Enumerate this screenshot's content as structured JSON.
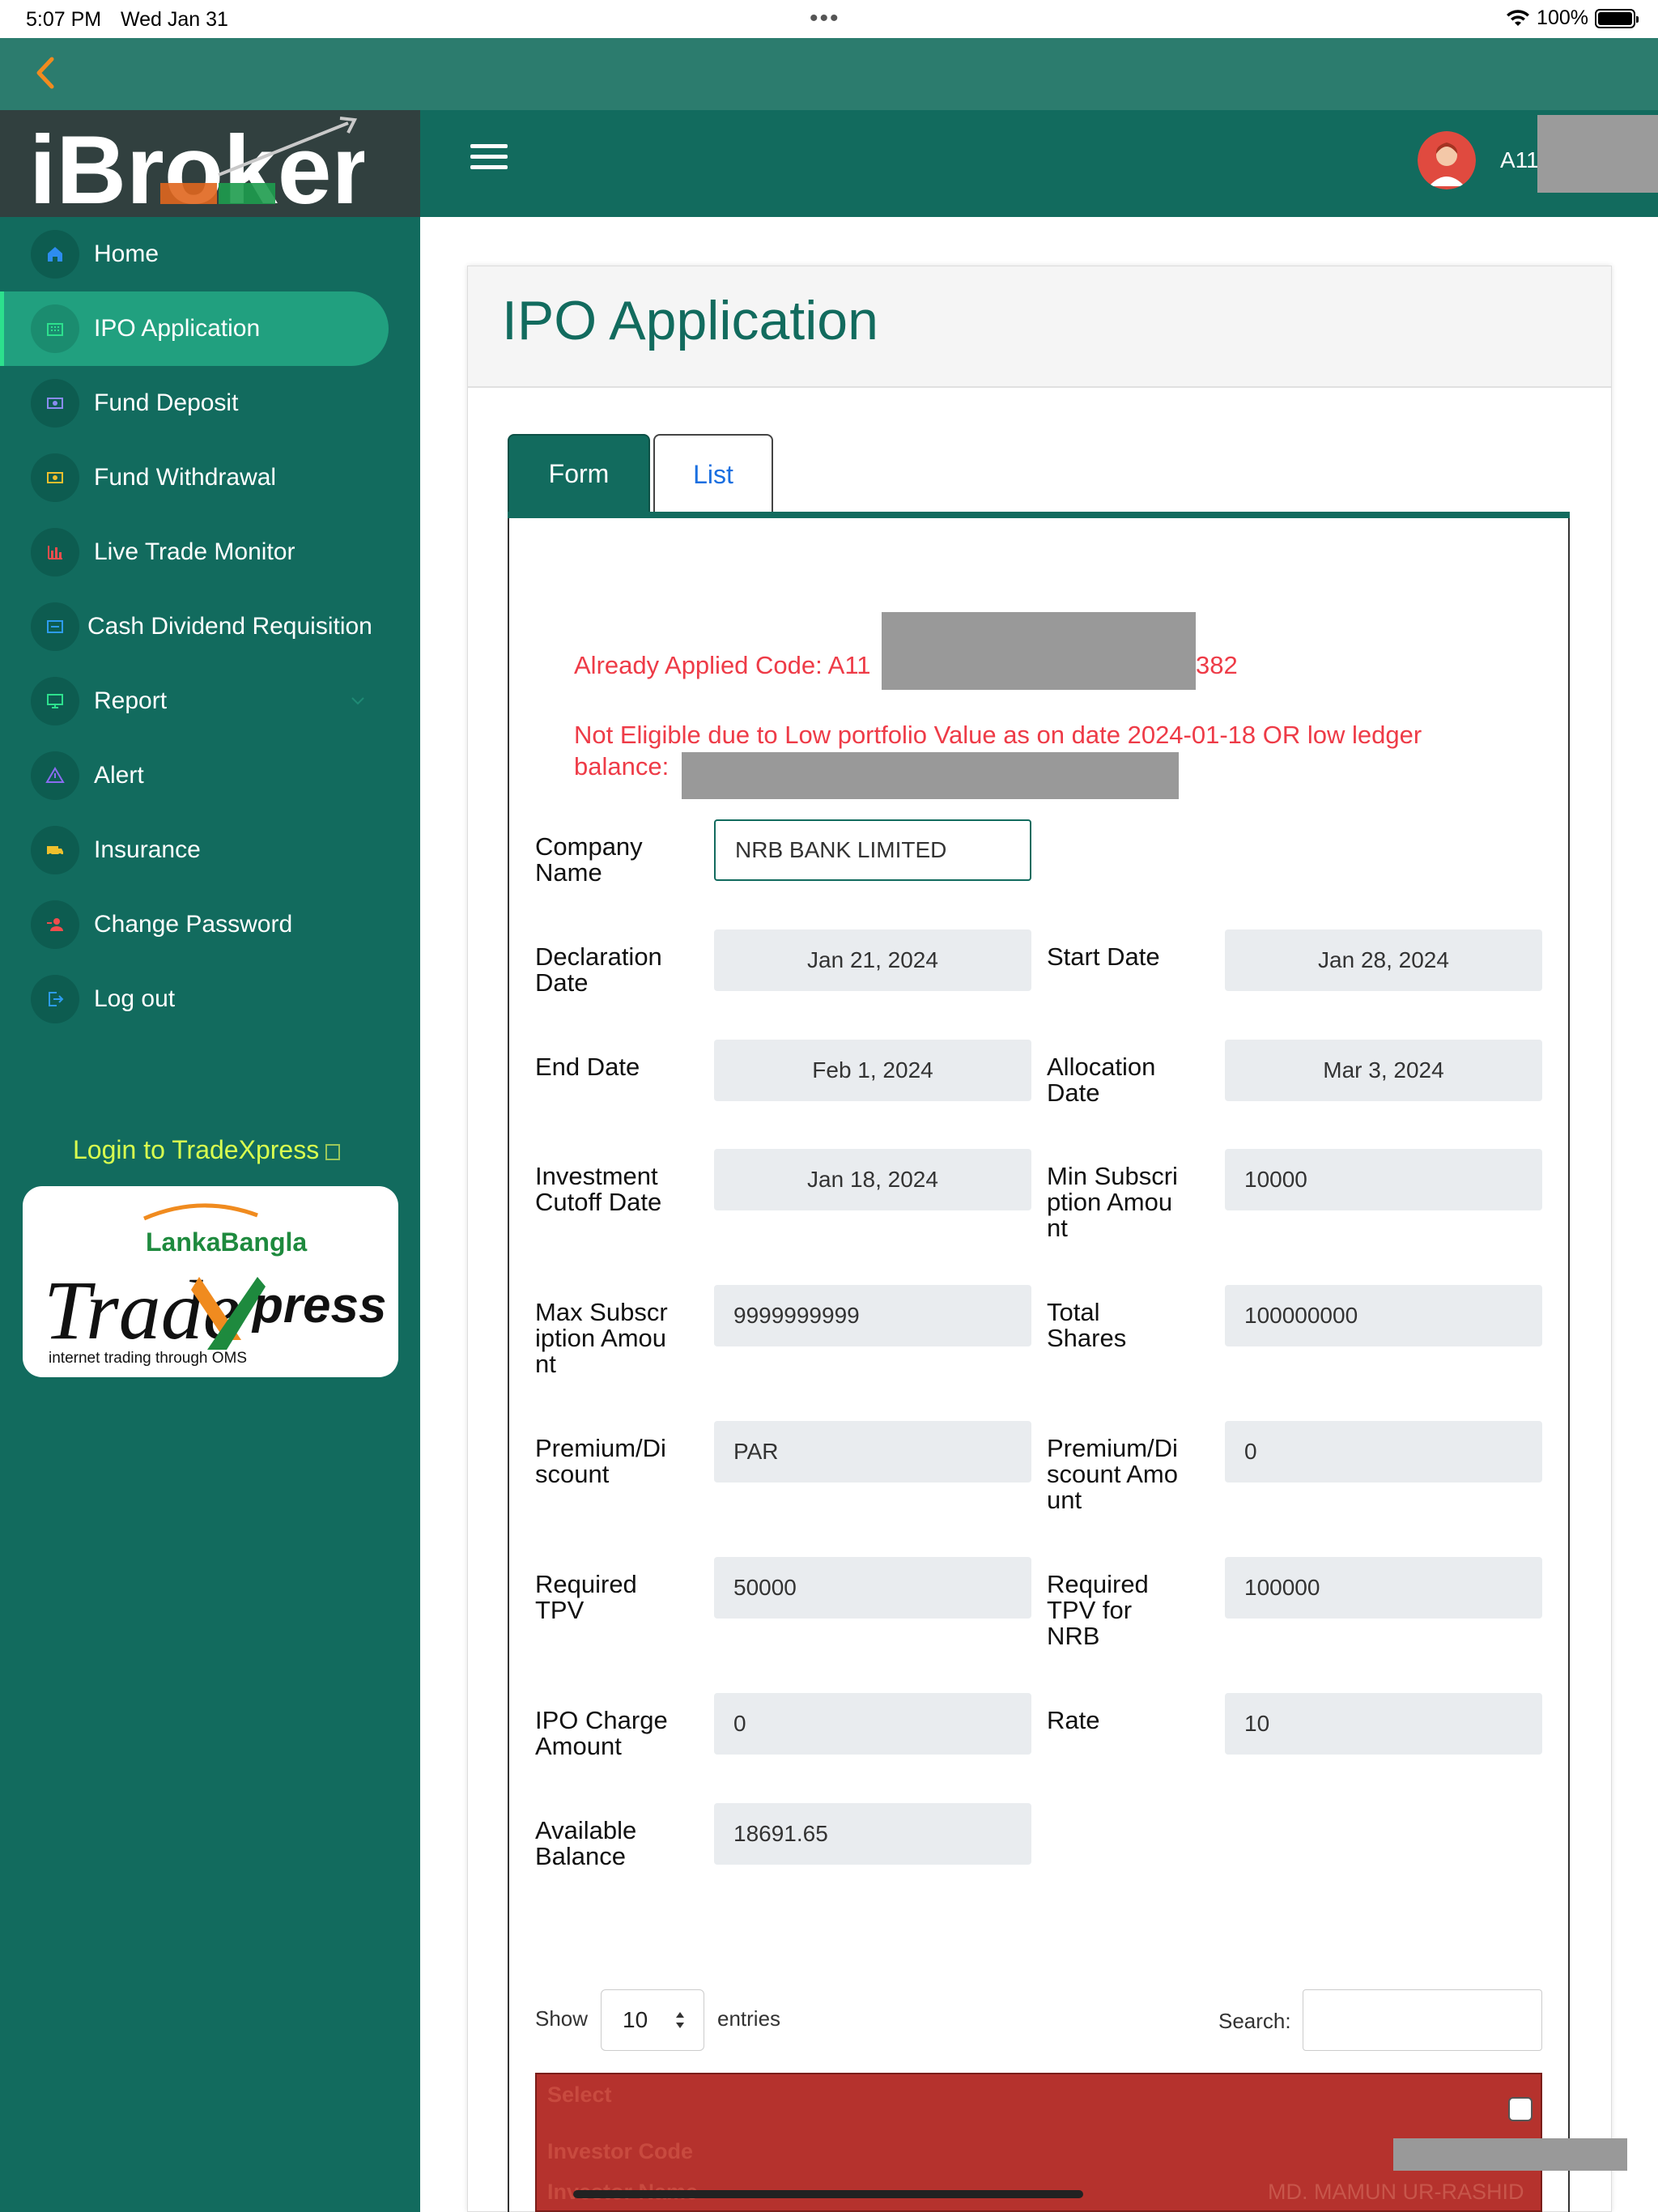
{
  "status_bar": {
    "time": "5:07 PM",
    "date": "Wed Jan 31",
    "battery": "100%",
    "battery_level": 1.0
  },
  "brand": {
    "logo_text": "iBroker"
  },
  "header": {
    "user_id": "A11"
  },
  "sidebar": {
    "items": [
      {
        "label": "Home",
        "icon": "home-icon",
        "active": false
      },
      {
        "label": "IPO Application",
        "icon": "ipo-icon",
        "active": true
      },
      {
        "label": "Fund Deposit",
        "icon": "deposit-icon",
        "active": false
      },
      {
        "label": "Fund Withdrawal",
        "icon": "withdrawal-icon",
        "active": false
      },
      {
        "label": "Live Trade Monitor",
        "icon": "chart-icon",
        "active": false
      },
      {
        "label": "Cash Dividend Requisition",
        "icon": "dividend-icon",
        "active": false
      },
      {
        "label": "Report",
        "icon": "monitor-icon",
        "active": false
      },
      {
        "label": "Alert",
        "icon": "warning-icon",
        "active": false
      },
      {
        "label": "Insurance",
        "icon": "ambulance-icon",
        "active": false
      },
      {
        "label": "Change Password",
        "icon": "user-key-icon",
        "active": false
      },
      {
        "label": "Log out",
        "icon": "logout-icon",
        "active": false
      }
    ],
    "tradexpress_link": "Login to TradeXpress",
    "tradexpress_card": {
      "brand": "LankaBangla",
      "product": "TradeXpress",
      "product_a": "Trade",
      "product_b": "press",
      "tagline": "internet trading through OMS"
    }
  },
  "page": {
    "title": "IPO Application",
    "tabs": [
      {
        "label": "Form",
        "active": true
      },
      {
        "label": "List",
        "active": false
      }
    ],
    "alerts": {
      "applied_prefix": "Already Applied Code: A11",
      "applied_suffix": "382",
      "ineligible_line1": "Not Eligible due to Low portfolio Value as on date 2024-01-18 OR low ledger",
      "ineligible_line2": "balance: "
    },
    "form": {
      "company_name_label": "Company Name",
      "company_name_value": "NRB BANK LIMITED",
      "declaration_date_label": "Declaration Date",
      "declaration_date_value": "Jan 21, 2024",
      "start_date_label": "Start Date",
      "start_date_value": "Jan 28, 2024",
      "end_date_label": "End Date",
      "end_date_value": "Feb 1, 2024",
      "allocation_date_label": "Allocation Date",
      "allocation_date_value": "Mar 3, 2024",
      "investment_cutoff_label": "Investment Cutoff Date",
      "investment_cutoff_value": "Jan 18, 2024",
      "min_subscription_label": "Min Subscription Amount",
      "min_subscription_value": "10000",
      "max_subscription_label": "Max Subscription Amount",
      "max_subscription_value": "9999999999",
      "total_shares_label": "Total Shares",
      "total_shares_value": "100000000",
      "premium_discount_label": "Premium/Discount",
      "premium_discount_value": "PAR",
      "premium_discount_amount_label": "Premium/Discount Amount",
      "premium_discount_amount_value": "0",
      "required_tpv_label": "Required TPV",
      "required_tpv_value": "50000",
      "required_tpv_nrb_label": "Required TPV for NRB",
      "required_tpv_nrb_value": "100000",
      "ipo_charge_label": "IPO Charge Amount",
      "ipo_charge_value": "0",
      "rate_label": "Rate",
      "rate_value": "10",
      "available_balance_label": "Available Balance",
      "available_balance_value": "18691.65"
    },
    "table": {
      "show_label": "Show",
      "entries_value": "10",
      "entries_label": "entries",
      "search_label": "Search:",
      "headers": [
        "Select",
        "Investor Code",
        "Investor Name"
      ],
      "investor_name": "MD. MAMUN UR-RASHID"
    }
  },
  "colors": {
    "primary": "#126b5e",
    "accent": "#21a07f",
    "alert": "#ee3b47",
    "table_header": "#b5322d",
    "link": "#d9ff4f"
  }
}
